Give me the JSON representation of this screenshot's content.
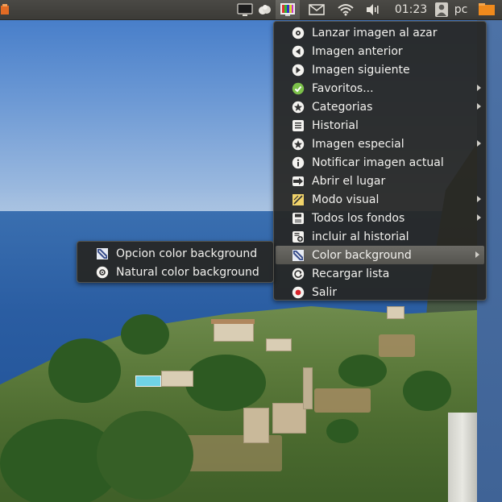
{
  "panel": {
    "clock": "01:23",
    "user": "pc",
    "icons": [
      "app-launcher-icon",
      "display-icon",
      "weather-cloud-icon",
      "wallpaper-changer-icon",
      "mail-icon",
      "wifi-icon",
      "volume-icon",
      "user-icon",
      "orange-folder-icon"
    ]
  },
  "menu": {
    "items": [
      {
        "label": "Lanzar imagen al azar",
        "icon": "launch-icon",
        "submenu": false
      },
      {
        "label": "Imagen anterior",
        "icon": "previous-icon",
        "submenu": false
      },
      {
        "label": "Imagen siguiente",
        "icon": "next-icon",
        "submenu": false
      },
      {
        "label": "Favoritos...",
        "icon": "favorites-check-icon",
        "submenu": true
      },
      {
        "label": "Categorias",
        "icon": "categories-star-icon",
        "submenu": true
      },
      {
        "label": "Historial",
        "icon": "history-list-icon",
        "submenu": false
      },
      {
        "label": "Imagen especial",
        "icon": "special-star-icon",
        "submenu": true
      },
      {
        "label": "Notificar imagen actual",
        "icon": "info-icon",
        "submenu": false
      },
      {
        "label": "Abrir el lugar",
        "icon": "open-location-icon",
        "submenu": false
      },
      {
        "label": "Modo visual",
        "icon": "visual-mode-icon",
        "submenu": true
      },
      {
        "label": "Todos los fondos",
        "icon": "save-icon",
        "submenu": true
      },
      {
        "label": "incluir al historial",
        "icon": "add-history-icon",
        "submenu": false
      },
      {
        "label": "Color background",
        "icon": "color-pencil-icon",
        "submenu": true,
        "selected": true
      },
      {
        "label": "Recargar lista",
        "icon": "reload-icon",
        "submenu": false
      },
      {
        "label": "Salir",
        "icon": "quit-icon",
        "submenu": false
      }
    ]
  },
  "submenu": {
    "items": [
      {
        "label": "Opcion color background",
        "icon": "color-pencil-icon"
      },
      {
        "label": "Natural color background",
        "icon": "natural-color-icon"
      }
    ]
  }
}
